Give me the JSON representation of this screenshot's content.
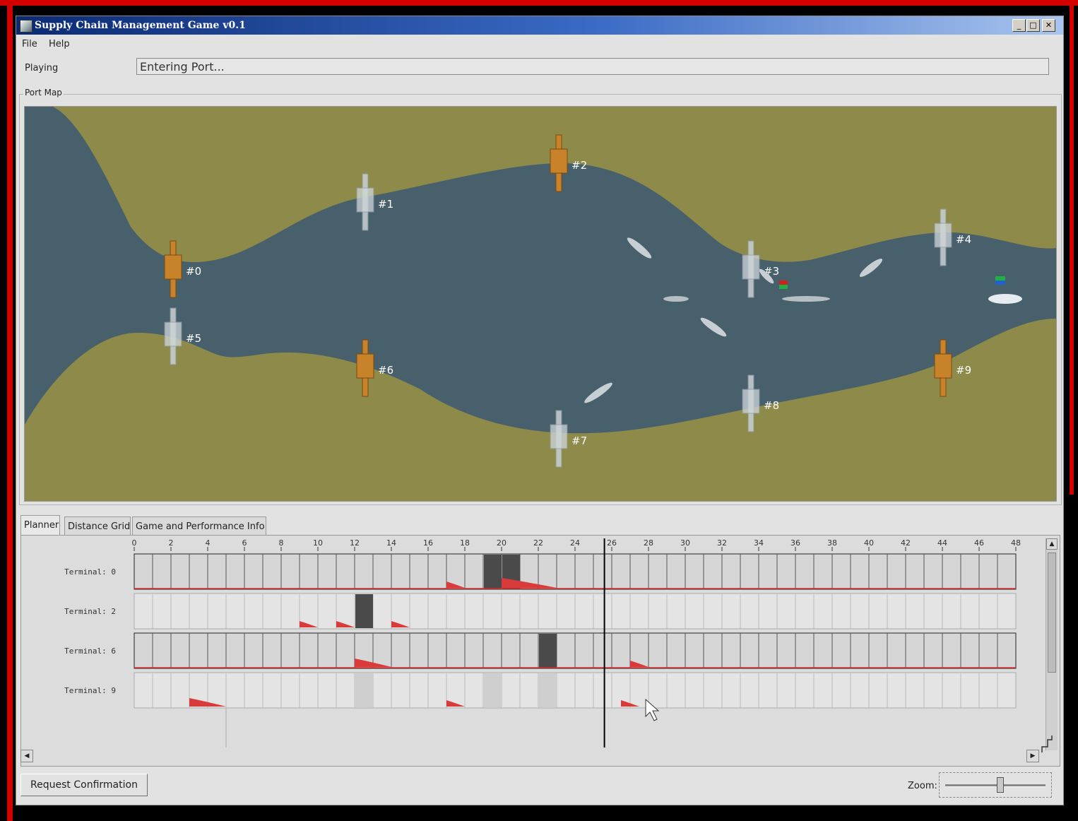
{
  "window": {
    "title": "Supply Chain Management Game v0.1",
    "controls": {
      "minimize": "_",
      "maximize": "□",
      "close": "✕"
    },
    "icon": "app-icon"
  },
  "menu": [
    "File",
    "Help"
  ],
  "status": {
    "label": "Playing",
    "value": "Entering Port..."
  },
  "port_map": {
    "legend": "Port Map",
    "colors": {
      "land": "#8d8a4a",
      "water": "#48606b"
    },
    "ports": [
      {
        "label": "#0",
        "color": "orange"
      },
      {
        "label": "#1",
        "color": "white"
      },
      {
        "label": "#2",
        "color": "orange"
      },
      {
        "label": "#3",
        "color": "white"
      },
      {
        "label": "#4",
        "color": "white"
      },
      {
        "label": "#5",
        "color": "white"
      },
      {
        "label": "#6",
        "color": "orange"
      },
      {
        "label": "#7",
        "color": "white"
      },
      {
        "label": "#8",
        "color": "white"
      },
      {
        "label": "#9",
        "color": "orange"
      }
    ]
  },
  "tabs": [
    "Planner",
    "Distance Grid",
    "Game and Performance Info"
  ],
  "planner": {
    "hour_ticks": [
      "0",
      "2",
      "4",
      "6",
      "8",
      "10",
      "12",
      "14",
      "16",
      "18",
      "20",
      "22",
      "24",
      "26",
      "28",
      "30",
      "32",
      "34",
      "36",
      "38",
      "40",
      "42",
      "44",
      "46",
      "48"
    ],
    "current_hour": 25.6,
    "rows": [
      {
        "label": "Terminal: 0",
        "active": true,
        "blocks": [
          19,
          20
        ],
        "arrivals": [
          {
            "start": 17,
            "end": 18
          },
          {
            "start": 20,
            "end": 23
          }
        ]
      },
      {
        "label": "Terminal: 2",
        "active": false,
        "blocks": [
          12
        ],
        "arrivals": [
          {
            "start": 9,
            "end": 10
          },
          {
            "start": 11,
            "end": 12
          },
          {
            "start": 14,
            "end": 15
          }
        ]
      },
      {
        "label": "Terminal: 6",
        "active": true,
        "blocks": [
          22
        ],
        "arrivals": [
          {
            "start": 12,
            "end": 14
          },
          {
            "start": 27,
            "end": 28
          }
        ]
      },
      {
        "label": "Terminal: 9",
        "active": false,
        "blocks": [],
        "faded_blocks": [
          12,
          19,
          22
        ],
        "arrivals": [
          {
            "start": 3,
            "end": 5
          },
          {
            "start": 17,
            "end": 18
          },
          {
            "start": 26.5,
            "end": 27.5
          }
        ]
      }
    ]
  },
  "buttons": {
    "request": "Request Confirmation"
  },
  "zoom": {
    "label": "Zoom:",
    "value": 0.55
  }
}
